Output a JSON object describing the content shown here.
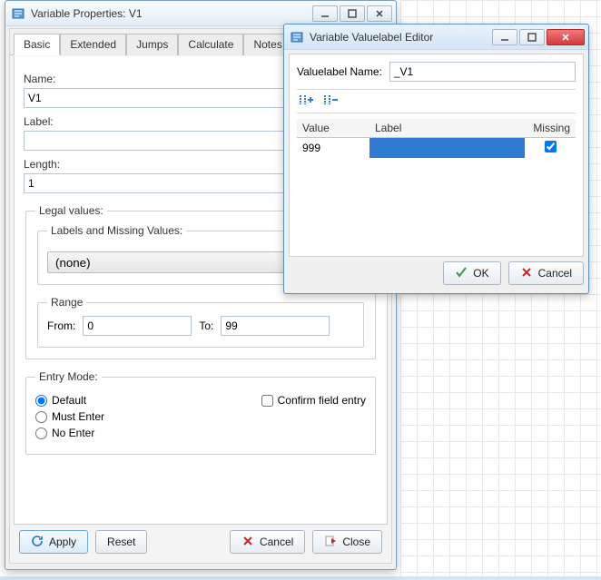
{
  "win1": {
    "title": "Variable Properties: V1",
    "tabs": [
      "Basic",
      "Extended",
      "Jumps",
      "Calculate",
      "Notes"
    ],
    "active_tab": 0,
    "name_label": "Name:",
    "name_value": "V1",
    "label_label": "Label:",
    "label_value": "",
    "length_label": "Length:",
    "length_value": "1",
    "legal_legend": "Legal values:",
    "lmv_legend": "Labels and Missing Values:",
    "lmv_button": "(none)",
    "range_legend": "Range",
    "from_label": "From:",
    "from_value": "0",
    "to_label": "To:",
    "to_value": "99",
    "entry_legend": "Entry Mode:",
    "entry_options": [
      "Default",
      "Must Enter",
      "No Enter"
    ],
    "entry_selected": 0,
    "confirm_label": "Confirm field entry",
    "confirm_checked": false,
    "buttons": {
      "apply": "Apply",
      "reset": "Reset",
      "cancel": "Cancel",
      "close": "Close"
    }
  },
  "win2": {
    "title": "Variable Valuelabel Editor",
    "vl_name_label": "Valuelabel Name:",
    "vl_name_value": "_V1",
    "columns": {
      "value": "Value",
      "label": "Label",
      "missing": "Missing"
    },
    "rows": [
      {
        "value": "999",
        "label": "",
        "missing": true
      }
    ],
    "buttons": {
      "ok": "OK",
      "cancel": "Cancel"
    }
  }
}
